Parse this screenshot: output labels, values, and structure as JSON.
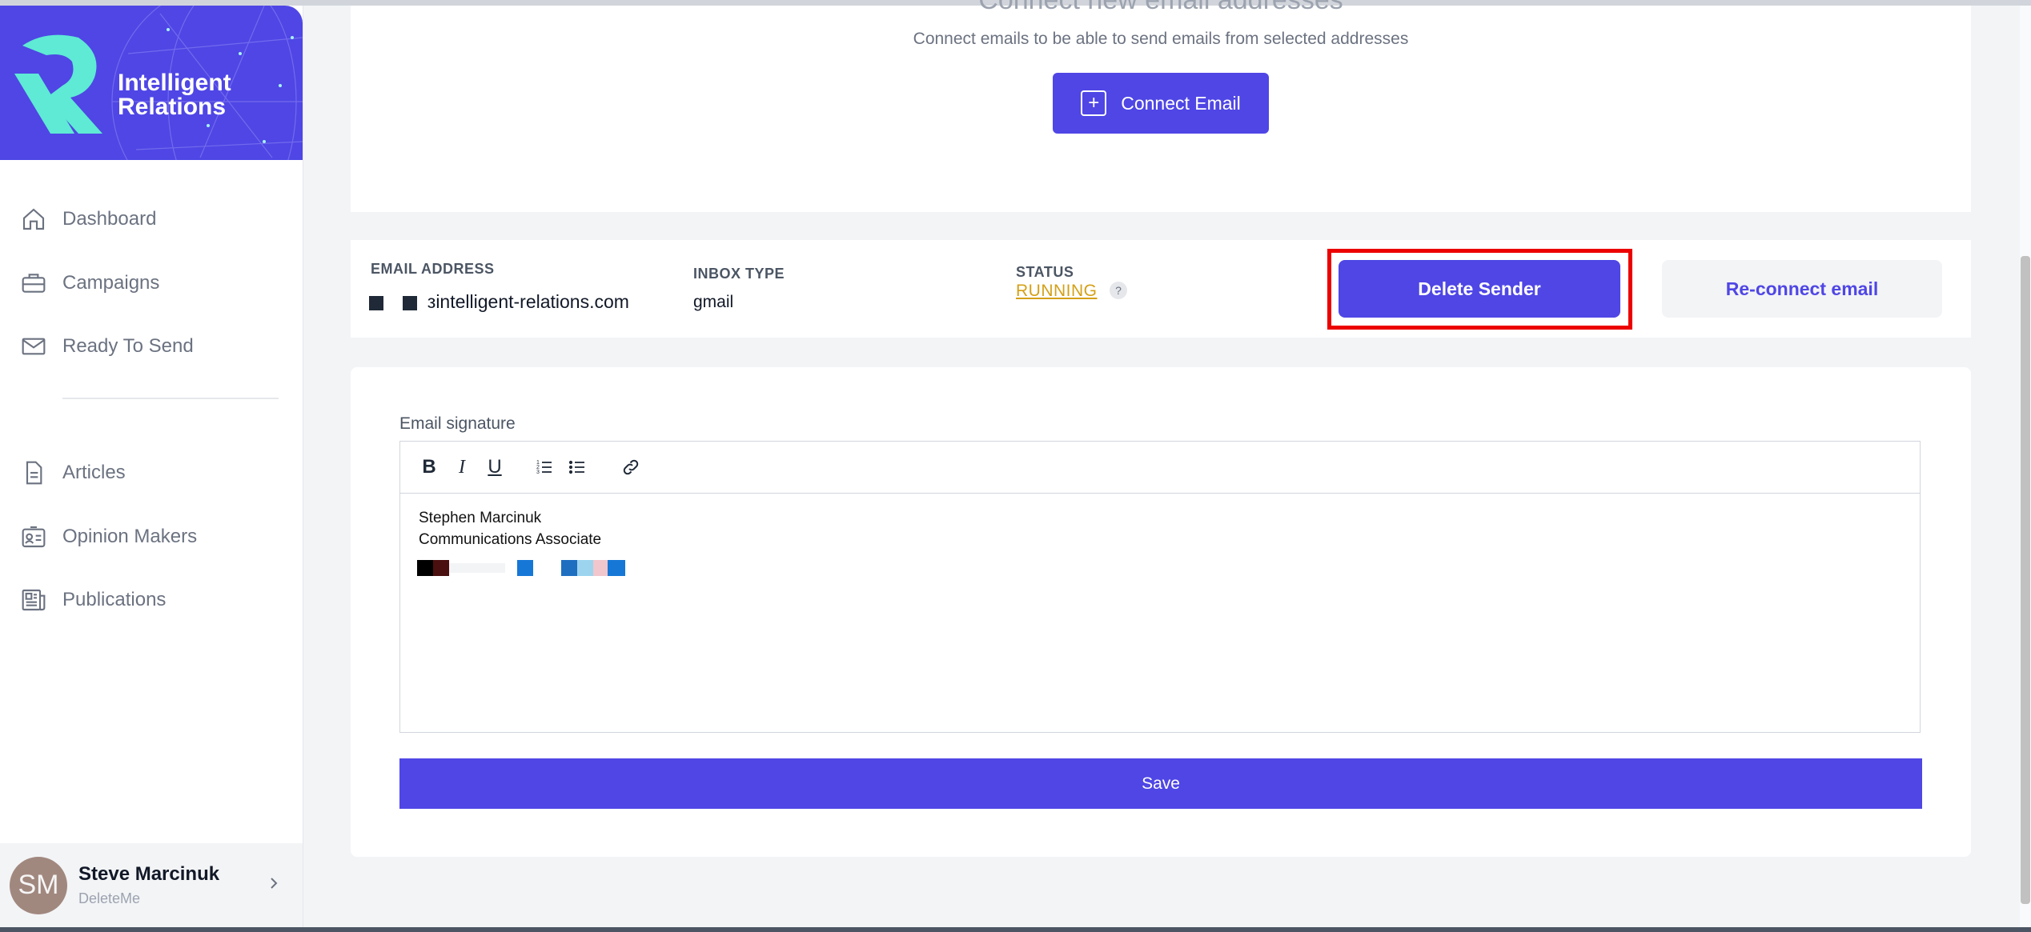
{
  "brand": {
    "line1": "Intelligent",
    "line2": "Relations",
    "color": "#4f46e5",
    "accent": "#5eead4"
  },
  "sidebar": {
    "items": [
      {
        "label": "Dashboard",
        "icon": "home-icon"
      },
      {
        "label": "Campaigns",
        "icon": "briefcase-icon"
      },
      {
        "label": "Ready To Send",
        "icon": "mail-icon"
      },
      {
        "label": "Articles",
        "icon": "document-icon"
      },
      {
        "label": "Opinion Makers",
        "icon": "id-card-icon"
      },
      {
        "label": "Publications",
        "icon": "newspaper-icon"
      }
    ],
    "user": {
      "initials": "SM",
      "name": "Steve Marcinuk",
      "subtitle": "DeleteMe"
    }
  },
  "connect": {
    "title": "Connect new email addresses",
    "subtitle": "Connect emails to be able to send emails from selected addresses",
    "button_label": "Connect Email"
  },
  "sender": {
    "email_header": "EMAIL ADDRESS",
    "email_value": "зintelligent-relations.com",
    "inbox_header": "INBOX TYPE",
    "inbox_value": "gmail",
    "status_header": "STATUS",
    "status_value": "RUNNING",
    "help_label": "?",
    "delete_label": "Delete Sender",
    "reconnect_label": "Re-connect email"
  },
  "signature": {
    "label": "Email signature",
    "toolbar": {
      "bold": "B",
      "italic": "I",
      "underline": "U"
    },
    "lines": [
      "Stephen Marcinuk",
      "Communications Associate"
    ],
    "save_label": "Save"
  },
  "colors": {
    "primary": "#4f46e5",
    "status_running": "#d4a017",
    "highlight_red": "#ec0000"
  }
}
